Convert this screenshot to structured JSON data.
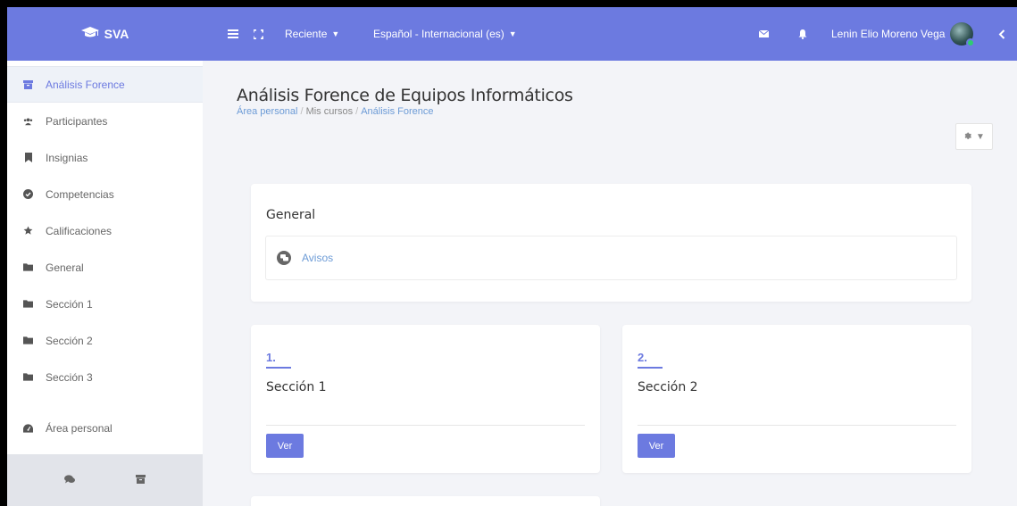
{
  "topbar": {
    "brand": "SVA",
    "recent_label": "Reciente",
    "language_label": "Español - Internacional (es)",
    "user_name": "Lenin Elio Moreno Vega"
  },
  "sidebar": {
    "items": [
      {
        "label": "Análisis Forence",
        "icon": "archive-icon",
        "active": true
      },
      {
        "label": "Participantes",
        "icon": "users-icon"
      },
      {
        "label": "Insignias",
        "icon": "bookmark-icon"
      },
      {
        "label": "Competencias",
        "icon": "check-circle-icon"
      },
      {
        "label": "Calificaciones",
        "icon": "star-icon"
      },
      {
        "label": "General",
        "icon": "folder-icon"
      },
      {
        "label": "Sección 1",
        "icon": "folder-icon"
      },
      {
        "label": "Sección 2",
        "icon": "folder-icon"
      },
      {
        "label": "Sección 3",
        "icon": "folder-icon"
      }
    ],
    "dashboard_label": "Área personal"
  },
  "main": {
    "page_title": "Análisis Forence de Equipos Informáticos",
    "breadcrumb": [
      "Área personal",
      "Mis cursos",
      "Análisis Forence"
    ],
    "general": {
      "title": "General",
      "activity_label": "Avisos"
    },
    "sections": [
      {
        "number": "1.",
        "title": "Sección 1",
        "button": "Ver"
      },
      {
        "number": "2.",
        "title": "Sección 2",
        "button": "Ver"
      }
    ]
  },
  "colors": {
    "accent": "#6c7ae0",
    "link": "#6c9bd6",
    "sidebar_active_bg": "#eef2f8"
  }
}
